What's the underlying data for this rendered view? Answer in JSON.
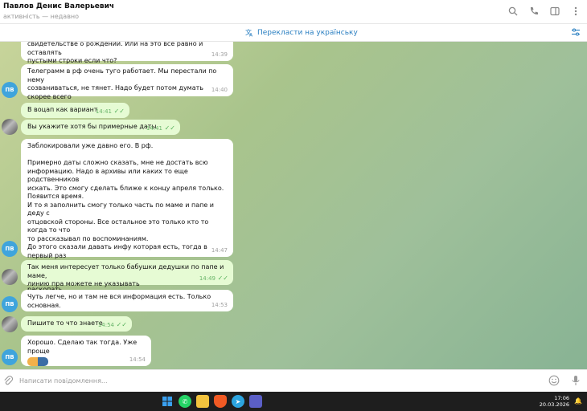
{
  "header": {
    "title": "Павлов Денис Валерьевич",
    "status": "активність — недавно"
  },
  "translate_bar": {
    "label": "Перекласти на українську"
  },
  "messages": [
    {
      "dir": "in",
      "text": "свидетельстве о рождении. Или на это все равно и оставлять\nпустыми строки если что?",
      "time": "14:39"
    },
    {
      "dir": "in",
      "text": "Телеграмм в рф очень туго работает. Мы перестали по нему\nсозваниваться, не тянет. Надо будет потом думать скорее всего\nкак связываться.",
      "time": "14:40",
      "avatar": "ПВ"
    },
    {
      "dir": "out",
      "text": "В воцап как вариант",
      "time": "14:41"
    },
    {
      "dir": "out",
      "text": "Вы укажите хотя бы примерные даты",
      "time": "14:41"
    },
    {
      "dir": "in",
      "text": "Заблокировали уже давно его. В рф.\n\nПримерно даты сложно сказать, мне не достать всю\nинформацию. Надо в архивы или каких то еще родственников\nискать. Это смогу сделать ближе к концу апреля только.\nПоявится время.\nИ то я заполнить смогу только часть по маме и папе и деду с\nотцовской стороны. Все остальное это только кто то когда то что\nто рассказывал по воспоминаниям.\nДо этого сказали давать инфу которая есть, тогда в первый раз\nее дал. Тут все гораздо глубже сейчас по списку. Пока работаю\nнад этим. Но гарантий не могу дать что новое смогу раскопать.",
      "time": "14:47",
      "avatar": "ПВ"
    },
    {
      "dir": "out",
      "text": "Так меня интересует только бабушки дедушки по папе и маме,\nлинию пра можете не указывать",
      "time": "14:49"
    },
    {
      "dir": "in",
      "text": "Чуть легче, но и там не вся информация есть. Только основная.",
      "time": "14:53",
      "avatar": "ПВ"
    },
    {
      "dir": "out",
      "text": "Пишите то что знаете",
      "time": "14:54"
    },
    {
      "dir": "in",
      "text": "Хорошо. Сделаю так тогда. Уже проще",
      "time": "14:54",
      "avatar": "ПВ"
    }
  ],
  "input": {
    "placeholder": "Написати повідомлення..."
  },
  "taskbar": {
    "time": "17:06",
    "date": "20.03.2026"
  },
  "colors": {
    "accent": "#2a7fc1",
    "outgoing_bubble": "#e6fbd4",
    "avatar": "#3fa4dc"
  }
}
